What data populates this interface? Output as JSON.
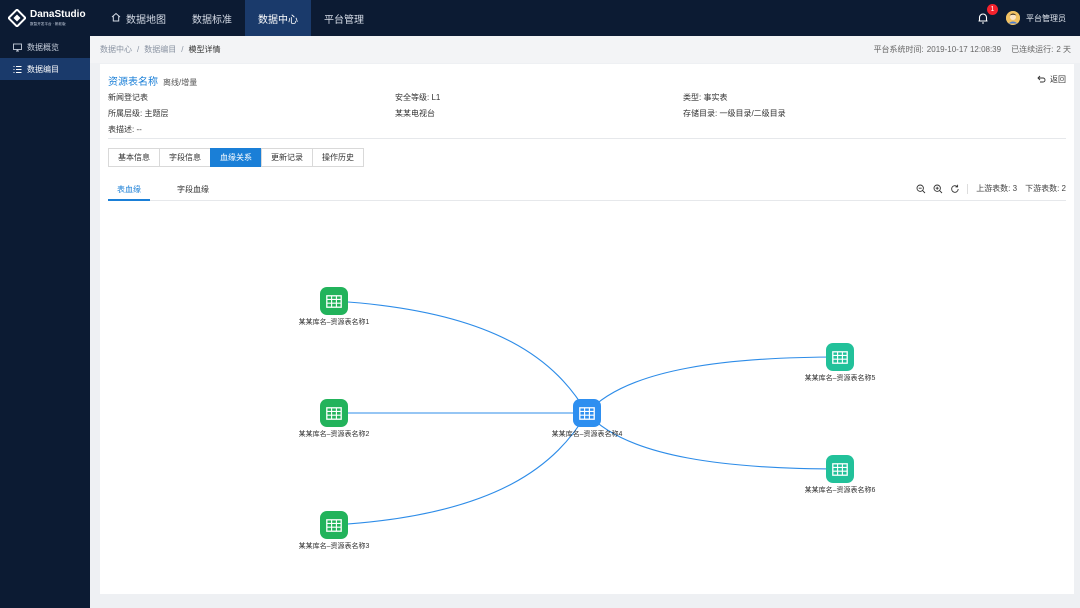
{
  "app": {
    "logo_name": "DanaStudio",
    "logo_sub": "数智开发平台 · 帆软版"
  },
  "nav": {
    "items": [
      {
        "label": "数据地图"
      },
      {
        "label": "数据标准"
      },
      {
        "label": "数据中心"
      },
      {
        "label": "平台管理"
      }
    ],
    "active": "数据中心",
    "notification_count": "1",
    "user_name": "平台管理员"
  },
  "sidebar": {
    "items": [
      {
        "label": "数据概览"
      },
      {
        "label": "数据编目"
      }
    ],
    "active": "数据编目"
  },
  "breadcrumb": {
    "items": [
      "数据中心",
      "数据编目",
      "模型详情"
    ]
  },
  "system": {
    "time_label": "平台系统时间:",
    "time_value": "2019-10-17 12:08:39",
    "uptime_label": "已连续运行:",
    "uptime_value": "2 天"
  },
  "detail": {
    "title": "资源表名称",
    "subtitle": "离线/增量",
    "back_label": "返回",
    "fields": {
      "news": "新闻登记表",
      "security": "安全等级: L1",
      "type": "类型: 事实表",
      "layer": "所属层级: 主题层",
      "org": "某某电视台",
      "storage": "存储目录: 一级目录/二级目录",
      "desc": "表描述: --"
    }
  },
  "tabs": {
    "items": [
      {
        "label": "基本信息"
      },
      {
        "label": "字段信息"
      },
      {
        "label": "血缘关系"
      },
      {
        "label": "更新记录"
      },
      {
        "label": "操作历史"
      }
    ],
    "active": "血缘关系"
  },
  "subtabs": {
    "items": [
      {
        "label": "表血缘"
      },
      {
        "label": "字段血缘"
      }
    ],
    "active": "表血缘",
    "upstream": "上游表数: 3",
    "downstream": "下游表数: 2"
  },
  "lineage": {
    "colors": {
      "upstream": "#22b35b",
      "center": "#2e8ff0",
      "downstream": "#22c19a",
      "edge": "#2d8ce8"
    },
    "nodes": [
      {
        "label": "某某库名–资源表名称1",
        "role": "upstream"
      },
      {
        "label": "某某库名–资源表名称2",
        "role": "upstream"
      },
      {
        "label": "某某库名–资源表名称3",
        "role": "upstream"
      },
      {
        "label": "某某库名–资源表名称4",
        "role": "center"
      },
      {
        "label": "某某库名–资源表名称5",
        "role": "downstream"
      },
      {
        "label": "某某库名–资源表名称6",
        "role": "downstream"
      }
    ]
  }
}
